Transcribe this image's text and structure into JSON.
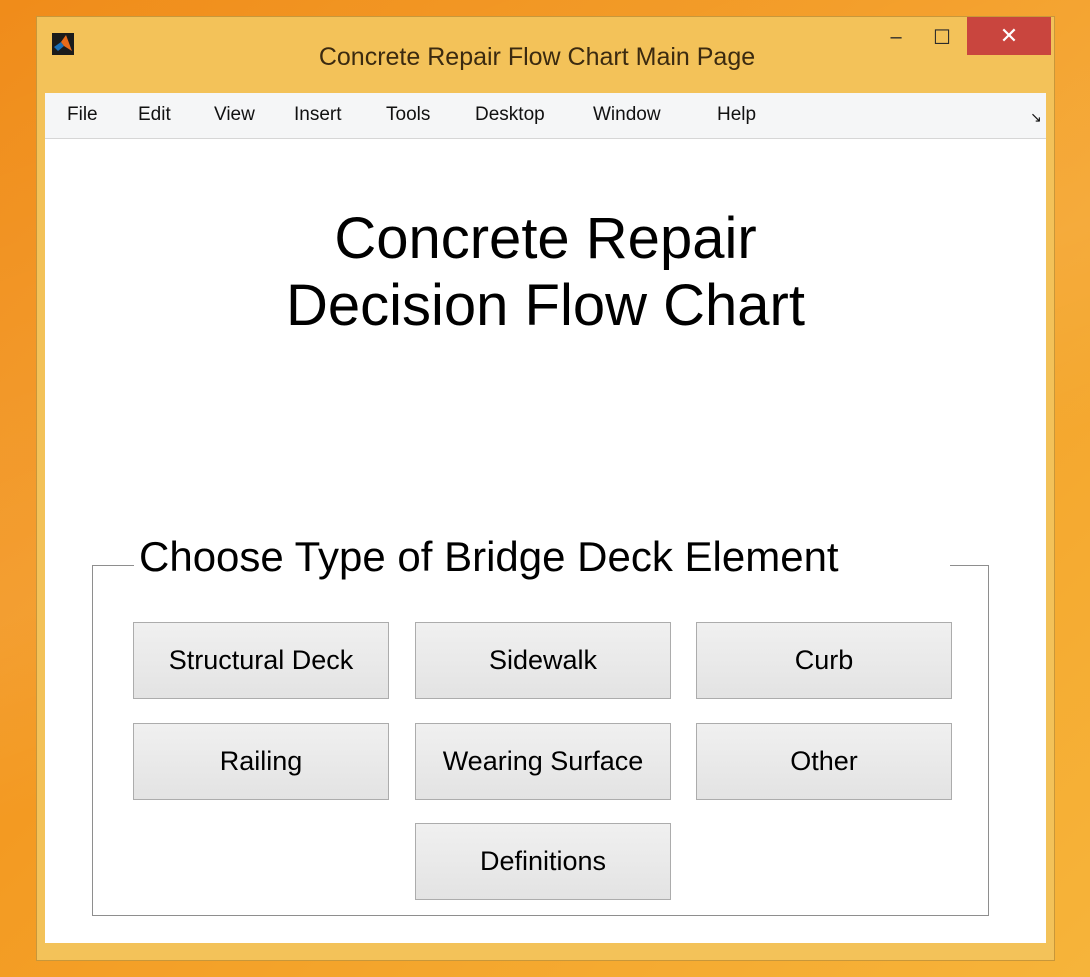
{
  "window": {
    "title": "Concrete Repair Flow Chart Main Page",
    "minimize_glyph": "‒",
    "maximize_glyph": "☐",
    "close_glyph": "✕"
  },
  "menubar": {
    "items": [
      "File",
      "Edit",
      "View",
      "Insert",
      "Tools",
      "Desktop",
      "Window",
      "Help"
    ],
    "toggle_glyph": "↘"
  },
  "main": {
    "heading_line1": "Concrete Repair",
    "heading_line2": "Decision Flow Chart"
  },
  "element_group": {
    "title": "Choose Type of Bridge Deck Element",
    "buttons": {
      "structural_deck": "Structural Deck",
      "sidewalk": "Sidewalk",
      "curb": "Curb",
      "railing": "Railing",
      "wearing_surface": "Wearing Surface",
      "other": "Other",
      "definitions": "Definitions"
    }
  },
  "colors": {
    "title_bar": "#f3c259",
    "close_button": "#c9453e",
    "desktop": "#f08c1a"
  }
}
